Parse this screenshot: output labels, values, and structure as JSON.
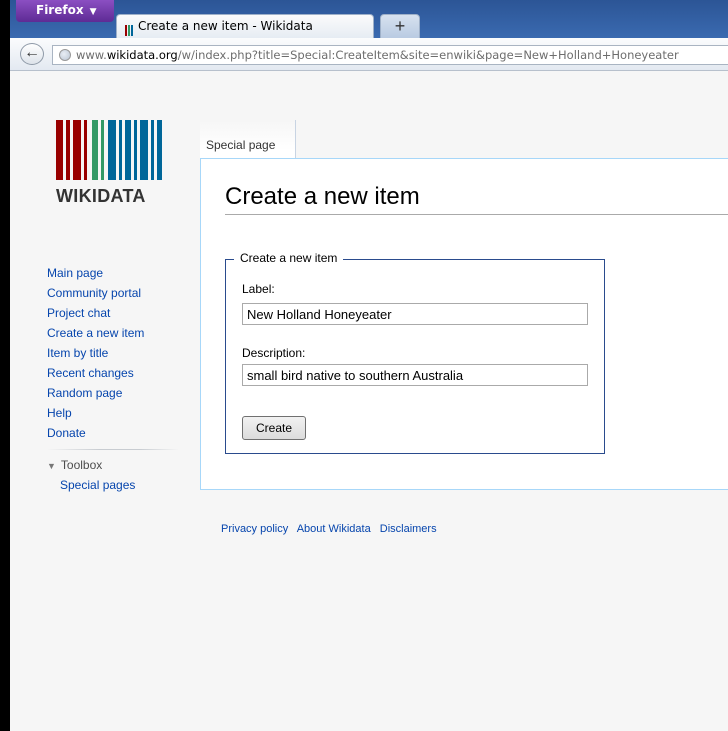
{
  "browser": {
    "menu_label": "Firefox",
    "tab_title": "Create a new item - Wikidata",
    "new_tab_label": "+",
    "url": {
      "prefix": "www.",
      "domain": "wikidata.org",
      "path": "/w/index.php?title=Special:CreateItem&site=enwiki&page=New+Holland+Honeyeater"
    }
  },
  "logo": {
    "text": "WIKIDATA",
    "bar_colors": [
      "#990000",
      "#339966",
      "#006699"
    ]
  },
  "sidebar": {
    "items": [
      {
        "label": "Main page"
      },
      {
        "label": "Community portal"
      },
      {
        "label": "Project chat"
      },
      {
        "label": "Create a new item"
      },
      {
        "label": "Item by title"
      },
      {
        "label": "Recent changes"
      },
      {
        "label": "Random page"
      },
      {
        "label": "Help"
      },
      {
        "label": "Donate"
      }
    ],
    "toolbox": {
      "label": "Toolbox",
      "items": [
        {
          "label": "Special pages"
        }
      ]
    }
  },
  "page": {
    "tab_label": "Special page",
    "heading": "Create a new item",
    "form": {
      "legend": "Create a new item",
      "label_field_label": "Label:",
      "label_value": "New Holland Honeyeater",
      "description_field_label": "Description:",
      "description_value": "small bird native to southern Australia",
      "submit_label": "Create"
    }
  },
  "footer": {
    "links": [
      "Privacy policy",
      "About Wikidata",
      "Disclaimers"
    ]
  },
  "colors": {
    "link": "#0645ad",
    "content_border": "#a7d7f9",
    "fieldset_border": "#2a4b8d"
  }
}
